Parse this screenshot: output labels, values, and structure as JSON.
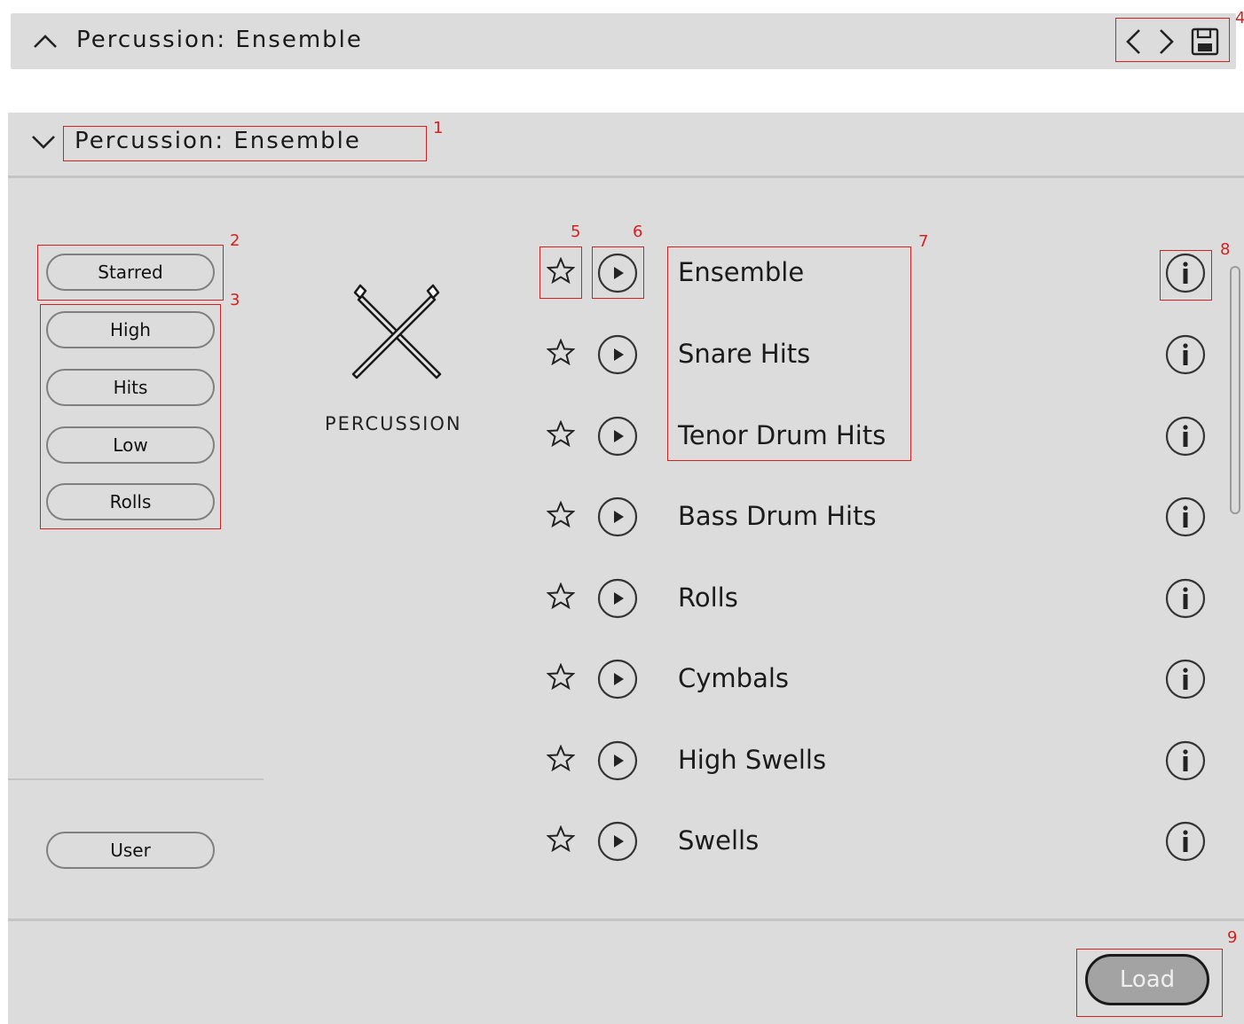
{
  "top_header": {
    "title": "Percussion: Ensemble"
  },
  "panel": {
    "title": "Percussion: Ensemble"
  },
  "filters": {
    "starred": "Starred",
    "tags": [
      "High",
      "Hits",
      "Low",
      "Rolls"
    ],
    "user": "User"
  },
  "category": {
    "label": "PERCUSSION",
    "icon": "crossed-mallets-icon"
  },
  "presets": [
    {
      "name": "Ensemble"
    },
    {
      "name": "Snare Hits"
    },
    {
      "name": "Tenor Drum Hits"
    },
    {
      "name": "Bass Drum Hits"
    },
    {
      "name": "Rolls"
    },
    {
      "name": "Cymbals"
    },
    {
      "name": "High Swells"
    },
    {
      "name": "Swells"
    }
  ],
  "footer": {
    "load_label": "Load"
  },
  "annotations": [
    "1",
    "2",
    "3",
    "4",
    "5",
    "6",
    "7",
    "8",
    "9"
  ],
  "colors": {
    "panel_bg": "#dcdcdc",
    "annotation": "#d61f1f",
    "load_bg": "#a3a3a3"
  }
}
